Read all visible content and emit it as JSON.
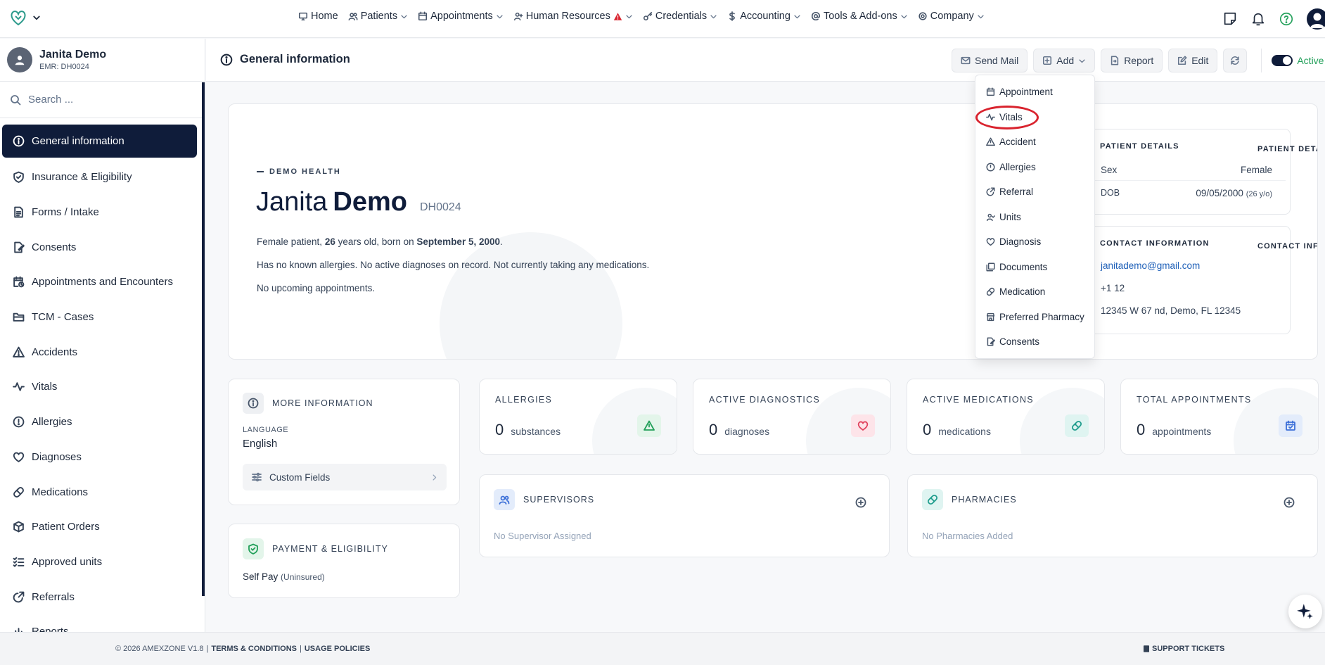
{
  "nav": {
    "items": [
      {
        "label": "Home",
        "icon": "monitor-icon",
        "caret": false
      },
      {
        "label": "Patients",
        "icon": "users-icon",
        "caret": true
      },
      {
        "label": "Appointments",
        "icon": "calendar-icon",
        "caret": true
      },
      {
        "label": "Human Resources",
        "icon": "user-plus-icon",
        "caret": true,
        "warning": true
      },
      {
        "label": "Credentials",
        "icon": "key-icon",
        "caret": true
      },
      {
        "label": "Accounting",
        "icon": "dollar-icon",
        "caret": true
      },
      {
        "label": "Tools & Add-ons",
        "icon": "at-icon",
        "caret": true
      },
      {
        "label": "Company",
        "icon": "gear-icon",
        "caret": true
      }
    ]
  },
  "patient": {
    "name": "Janita Demo",
    "emr": "EMR: DH0024"
  },
  "sidebar": {
    "search_placeholder": "Search ...",
    "items": [
      {
        "label": "General information",
        "active": true
      },
      {
        "label": "Insurance & Eligibility"
      },
      {
        "label": "Forms / Intake"
      },
      {
        "label": "Consents"
      },
      {
        "label": "Appointments and Encounters"
      },
      {
        "label": "TCM - Cases"
      },
      {
        "label": "Accidents"
      },
      {
        "label": "Vitals"
      },
      {
        "label": "Allergies"
      },
      {
        "label": "Diagnoses"
      },
      {
        "label": "Medications"
      },
      {
        "label": "Patient Orders"
      },
      {
        "label": "Approved units"
      },
      {
        "label": "Referrals"
      },
      {
        "label": "Reports"
      }
    ]
  },
  "header": {
    "title": "General information",
    "send_mail": "Send Mail",
    "add": "Add",
    "report": "Report",
    "edit": "Edit",
    "status": "Active"
  },
  "dropdown": {
    "items": [
      "Appointment",
      "Vitals",
      "Accident",
      "Allergies",
      "Referral",
      "Units",
      "Diagnosis",
      "Documents",
      "Medication",
      "Preferred Pharmacy",
      "Consents"
    ]
  },
  "hero": {
    "brand": "DEMO HEALTH",
    "first_name": "Janita",
    "last_name": "Demo",
    "emr": "DH0024",
    "line1_pre": "Female patient, ",
    "line1_age": "26",
    "line1_mid": " years old, born on ",
    "line1_dob": "September 5, 2000",
    "line1_end": ".",
    "line2": "Has no known allergies. No active diagnoses on record. Not currently taking any medications.",
    "line3": "No upcoming appointments."
  },
  "patient_details": {
    "title": "PATIENT DETAILS",
    "sex_label": "Sex",
    "sex_value": "Female",
    "dob_label": "DOB",
    "dob_value": "09/05/2000",
    "dob_age": "(26 y/o)"
  },
  "contact": {
    "title": "CONTACT INFORMATION",
    "email": "janitademo@gmail.com",
    "phone": "+1 12",
    "address": "12345 W 67 nd, Demo, FL 12345"
  },
  "more_info": {
    "title": "MORE INFORMATION",
    "language_label": "LANGUAGE",
    "language_value": "English",
    "custom_fields": "Custom Fields"
  },
  "payment": {
    "title": "PAYMENT & ELIGIBILITY",
    "value": "Self Pay",
    "note": "(Uninsured)"
  },
  "stats": [
    {
      "title": "ALLERGIES",
      "value": "0",
      "unit": "substances",
      "color": "#22a05a",
      "bg": "#e3f5ea"
    },
    {
      "title": "ACTIVE DIAGNOSTICS",
      "value": "0",
      "unit": "diagnoses",
      "color": "#e0435e",
      "bg": "#fde4e9"
    },
    {
      "title": "ACTIVE MEDICATIONS",
      "value": "0",
      "unit": "medications",
      "color": "#1e9c8c",
      "bg": "#dff4f1"
    },
    {
      "title": "TOTAL APPOINTMENTS",
      "value": "0",
      "unit": "appointments",
      "color": "#3b6fd8",
      "bg": "#e3ecfb"
    }
  ],
  "supervisors": {
    "title": "SUPERVISORS",
    "empty": "No Supervisor Assigned"
  },
  "pharmacies": {
    "title": "PHARMACIES",
    "empty": "No Pharmacies Added"
  },
  "footer": {
    "copyright": "© 2026 AMEXZONE V1.8",
    "terms": "TERMS & CONDITIONS",
    "usage": "USAGE POLICIES",
    "sep": "|",
    "support": "SUPPORT TICKETS"
  }
}
